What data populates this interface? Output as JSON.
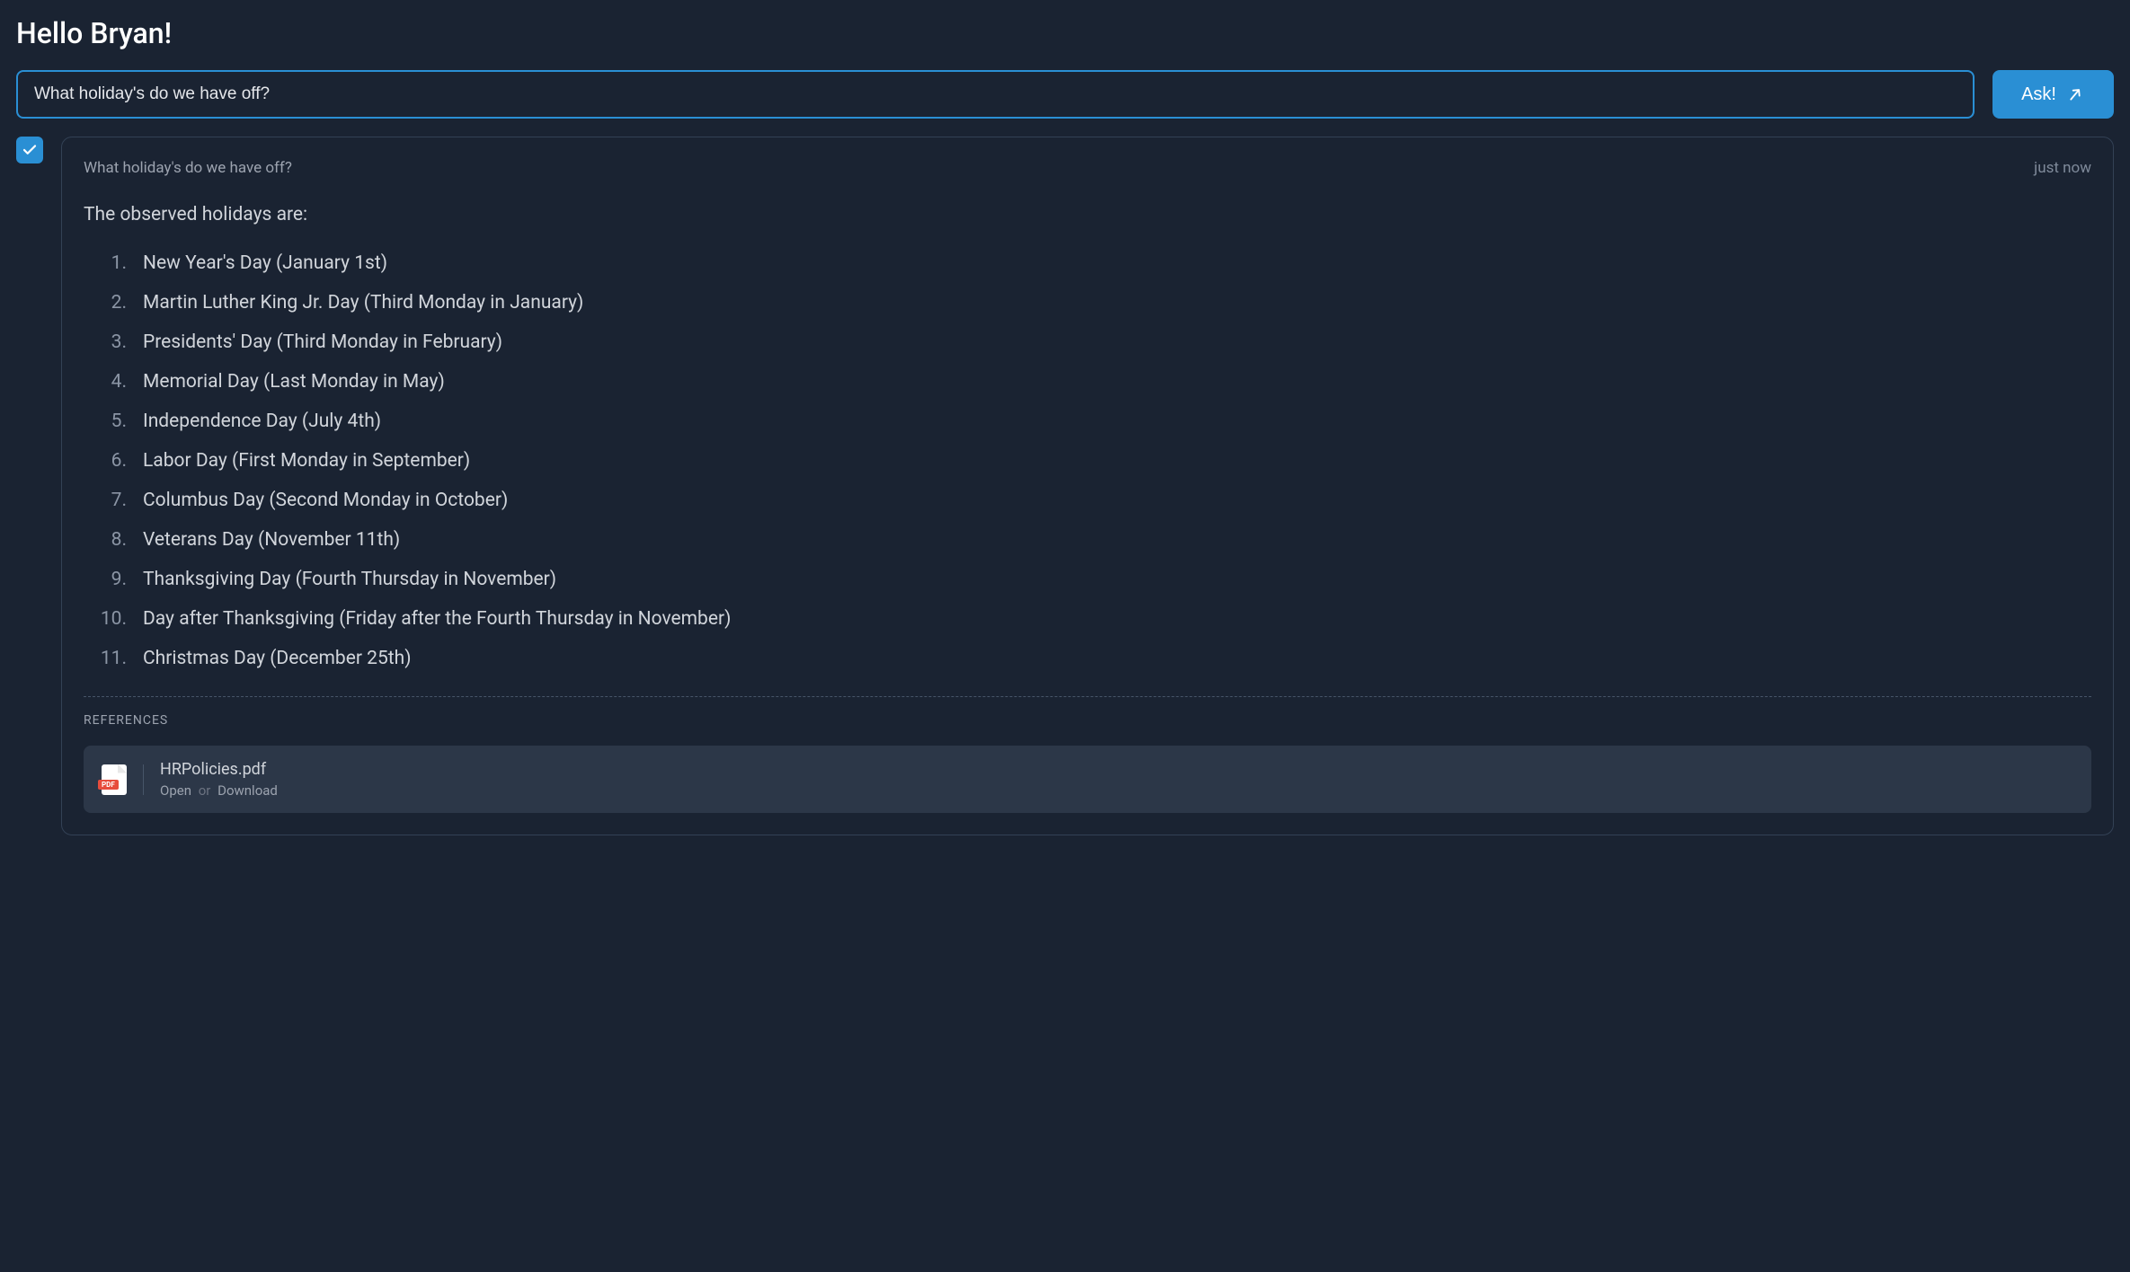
{
  "header": {
    "greeting": "Hello Bryan!"
  },
  "input": {
    "value": "What holiday's do we have off?",
    "ask_label": "Ask!"
  },
  "response": {
    "question_echo": "What holiday's do we have off?",
    "timestamp": "just now",
    "intro": "The observed holidays are:",
    "holidays": [
      "New Year's Day (January 1st)",
      "Martin Luther King Jr. Day (Third Monday in January)",
      "Presidents' Day (Third Monday in February)",
      "Memorial Day (Last Monday in May)",
      "Independence Day (July 4th)",
      "Labor Day (First Monday in September)",
      "Columbus Day (Second Monday in October)",
      "Veterans Day (November 11th)",
      "Thanksgiving Day (Fourth Thursday in November)",
      "Day after Thanksgiving (Friday after the Fourth Thursday in November)",
      "Christmas Day (December 25th)"
    ]
  },
  "references": {
    "label": "REFERENCES",
    "items": [
      {
        "filename": "HRPolicies.pdf",
        "open_label": "Open",
        "separator": "or",
        "download_label": "Download",
        "badge": "PDF"
      }
    ]
  }
}
